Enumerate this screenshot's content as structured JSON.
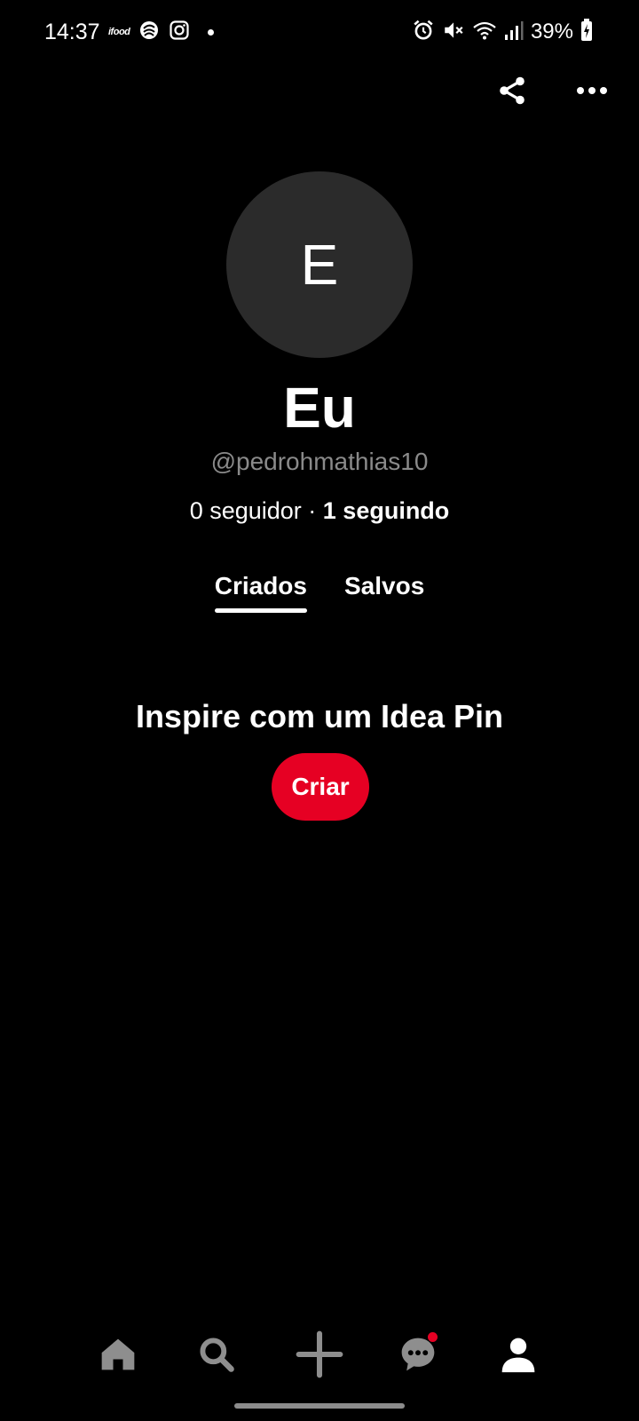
{
  "status_bar": {
    "time": "14:37",
    "ifood_label": "ifood",
    "battery": "39%",
    "icons_left": [
      "ifood-icon",
      "pinterest-like-icon",
      "instagram-icon",
      "notification-dot"
    ],
    "icons_right": [
      "alarm-icon",
      "mute-icon",
      "wifi-icon",
      "signal-icon",
      "battery-charging-icon"
    ]
  },
  "top_actions": {
    "share_icon": "share-icon",
    "more_icon": "more-horizontal-icon"
  },
  "profile": {
    "avatar_letter": "E",
    "name": "Eu",
    "handle": "@pedrohmathias10",
    "followers_text": "0 seguidor",
    "separator": " · ",
    "following_text": "1 seguindo"
  },
  "tabs": [
    {
      "label": "Criados",
      "active": true
    },
    {
      "label": "Salvos",
      "active": false
    }
  ],
  "empty_state": {
    "title": "Inspire com um Idea Pin",
    "button_label": "Criar"
  },
  "bottom_nav": {
    "items": [
      "home-icon",
      "search-icon",
      "plus-icon",
      "chat-icon",
      "profile-icon"
    ],
    "chat_has_badge": true
  },
  "colors": {
    "background": "#000000",
    "avatar_bg": "#2b2b2b",
    "accent_red": "#e60023",
    "handle_gray": "#8a8a8a",
    "inactive_icon": "#8e8e8e"
  }
}
